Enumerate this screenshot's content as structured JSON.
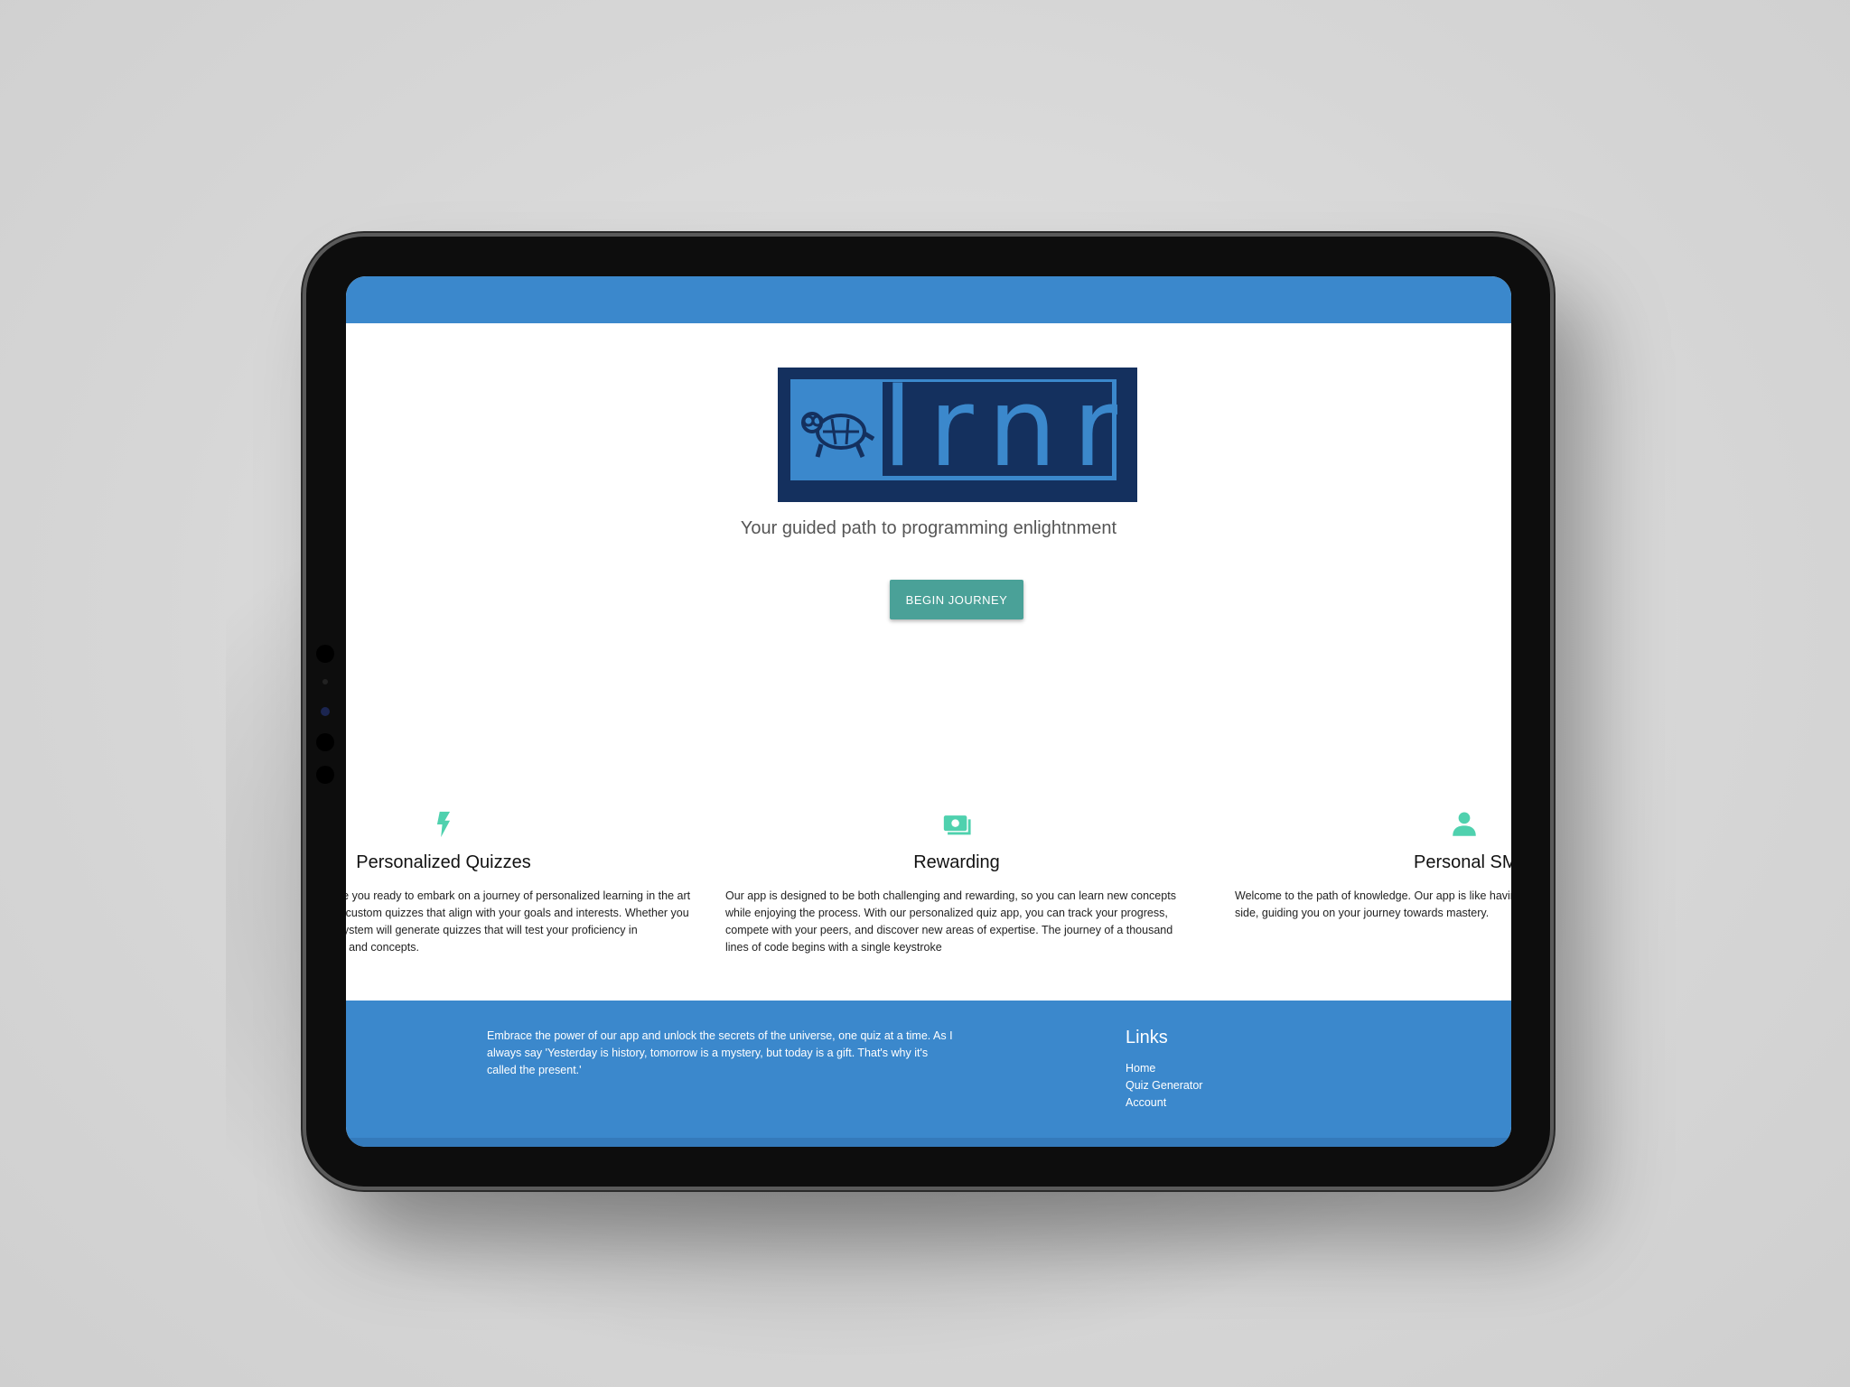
{
  "colors": {
    "primary": "#3b88cc",
    "logo_dark": "#14305e",
    "accent_button": "#4aa198",
    "feature_icon": "#4fd1ae"
  },
  "hero": {
    "logo_text": "lrnr",
    "tagline": "Your guided path to programming enlightnment",
    "cta_label": "BEGIN JOURNEY"
  },
  "features": [
    {
      "icon": "lightning-bolt-icon",
      "title": "Personalized Quizzes",
      "text": "Greetings, young padawan. Are you ready to embark on a journey of personalized learning in the art of coding? Our app can create custom quizzes that align with your goals and interests. Whether you are a novice or a master, our system will generate quizzes that will test your proficiency in programming languages, tools, and concepts."
    },
    {
      "icon": "money-icon",
      "title": "Rewarding",
      "text": "Our app is designed to be both challenging and rewarding, so you can learn new concepts while enjoying the process. With our personalized quiz app, you can track your progress, compete with your peers, and discover new areas of expertise. The journey of a thousand lines of code begins with a single keystroke"
    },
    {
      "icon": "person-icon",
      "title": "Personal SME",
      "text": "Welcome to the path of knowledge. Our app is like having a personal subject matter expert at your side, guiding you on your journey towards mastery."
    }
  ],
  "footer": {
    "text": "Embrace the power of our app and unlock the secrets of the universe, one quiz at a time. As I always say 'Yesterday is history, tomorrow is a mystery, but today is a gift. That's why it's called the present.'",
    "links_title": "Links",
    "links": [
      "Home",
      "Quiz Generator",
      "Account"
    ]
  }
}
